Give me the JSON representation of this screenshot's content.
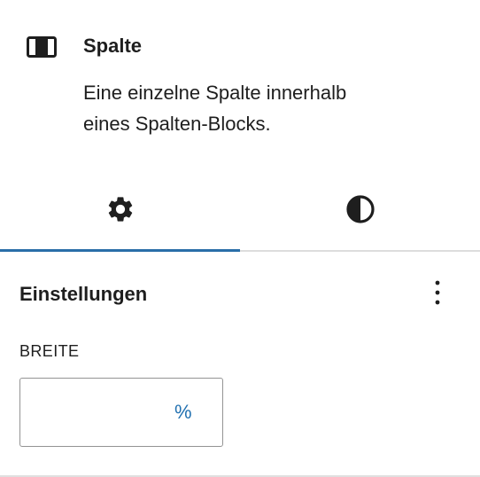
{
  "block_card": {
    "icon": "column-icon",
    "title": "Spalte",
    "description_line1": "Eine einzelne Spalte innerhalb",
    "description_line2": "eines Spalten-Blocks."
  },
  "tabs": [
    {
      "icon": "gear-icon",
      "active": true
    },
    {
      "icon": "half-circle-contrast-icon",
      "active": false
    }
  ],
  "settings": {
    "title": "Einstellungen",
    "more_icon": "more-vertical-icon",
    "width_label": "BREITE",
    "width_value": "",
    "width_unit": "%"
  },
  "colors": {
    "accent": "#2271b1",
    "tab_indicator": "#2a6ea8",
    "text": "#1e1e1e",
    "border": "#949494"
  }
}
